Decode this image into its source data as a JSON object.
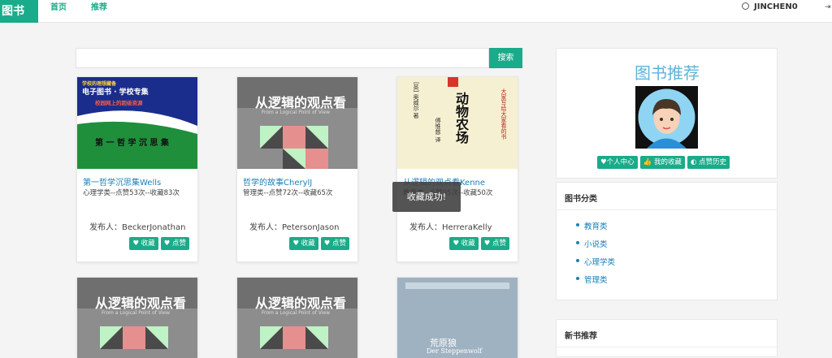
{
  "nav": {
    "brand": "图书",
    "links": [
      "首页",
      "推荐"
    ],
    "user": "JINCHEN0"
  },
  "search": {
    "value": "",
    "placeholder": "",
    "button": "搜索"
  },
  "cards": [
    {
      "title": "第一哲学沉思集Wells",
      "meta": "心理学类--点赞53次--收藏83次",
      "publisher": "发布人：BeckerJonathan",
      "collect": "收藏",
      "like": "点赞",
      "cover": {
        "series": "学校的理想藏备",
        "name": "电子图书 · 学校专集",
        "tagline": "校园网上的超级资源",
        "book": "第 一 哲 学 沉 思 集"
      }
    },
    {
      "title": "哲学的故事CherylJ",
      "meta": "管理类--点赞72次--收藏65次",
      "publisher": "发布人：PetersonJason",
      "collect": "收藏",
      "like": "点赞",
      "cover": {
        "book": "从逻辑的观点看",
        "sub": "From a Logical Point of View"
      }
    },
    {
      "title": "从逻辑的观点看Kenne",
      "meta": "教育类--点赞95次--收藏50次",
      "publisher": "发布人：HerreraKelly",
      "collect": "收藏",
      "like": "点赞",
      "cover": {
        "book": "动物农场",
        "author": "[英] 奥威尔 著",
        "translator": "傅惟慈 译",
        "side": "大家写给大家看的书"
      }
    }
  ],
  "cards_row2": [
    {
      "cover": {
        "book": "从逻辑的观点看",
        "sub": "From a Logical Point of View"
      }
    },
    {
      "cover": {
        "book": "从逻辑的观点看",
        "sub": "From a Logical Point of View"
      }
    },
    {
      "cover": {
        "book": "荒原狼",
        "sub": "Der Steppenwolf"
      }
    }
  ],
  "toast": "收藏成功!",
  "sidebar": {
    "rec_title": "图书推荐",
    "rec_buttons": [
      "个人中心",
      "我的收藏",
      "点赞历史"
    ],
    "category_title": "图书分类",
    "categories": [
      "教育类",
      "小说类",
      "心理学类",
      "管理类"
    ],
    "new_title": "新书推荐"
  },
  "colors": {
    "accent": "#1aab8a",
    "link": "#1a7fb8"
  }
}
